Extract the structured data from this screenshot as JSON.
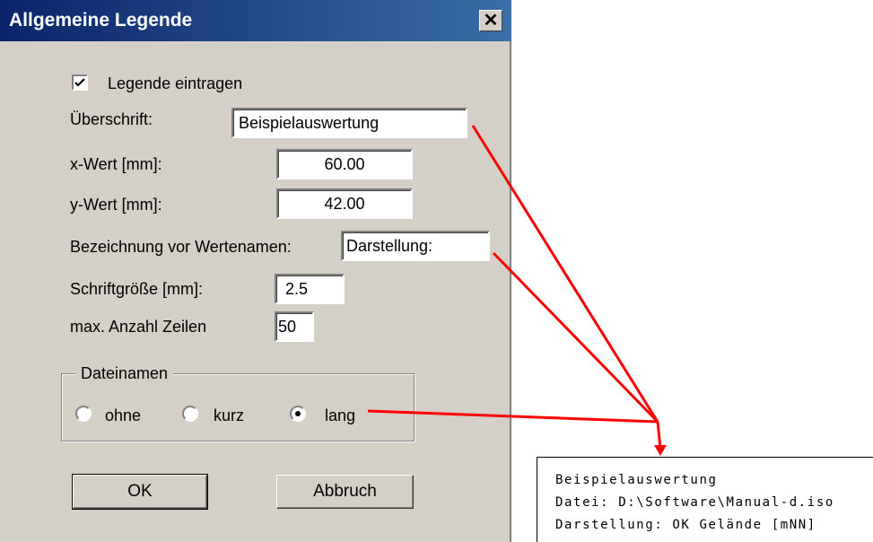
{
  "dialog": {
    "title": "Allgemeine Legende",
    "close_glyph": "✕",
    "legend_checkbox": {
      "label": "Legende eintragen",
      "checked": true
    },
    "fields": {
      "ueberschrift": {
        "label": "Überschrift:",
        "value": "Beispielauswertung"
      },
      "x_wert": {
        "label": "x-Wert [mm]:",
        "value": "60.00"
      },
      "y_wert": {
        "label": "y-Wert [mm]:",
        "value": "42.00"
      },
      "bezeichnung": {
        "label": "Bezeichnung vor Wertenamen:",
        "value": "Darstellung:"
      },
      "schriftgroesse": {
        "label": "Schriftgröße [mm]:",
        "value": "2.5"
      },
      "max_zeilen": {
        "label": "max. Anzahl Zeilen",
        "value": "50"
      }
    },
    "dateinamen": {
      "title": "Dateinamen",
      "options": [
        "ohne",
        "kurz",
        "lang"
      ],
      "selected": "lang"
    },
    "buttons": {
      "ok": "OK",
      "cancel": "Abbruch"
    }
  },
  "legend_preview": {
    "lines": [
      "Beispielauswertung",
      "Datei: D:\\Software\\Manual-d.iso",
      "Darstellung: OK Gelände [mNN]"
    ]
  },
  "colors": {
    "title_bar": "#0a246a",
    "dialog_bg": "#d4d0c8",
    "arrow": "#ff0000"
  }
}
